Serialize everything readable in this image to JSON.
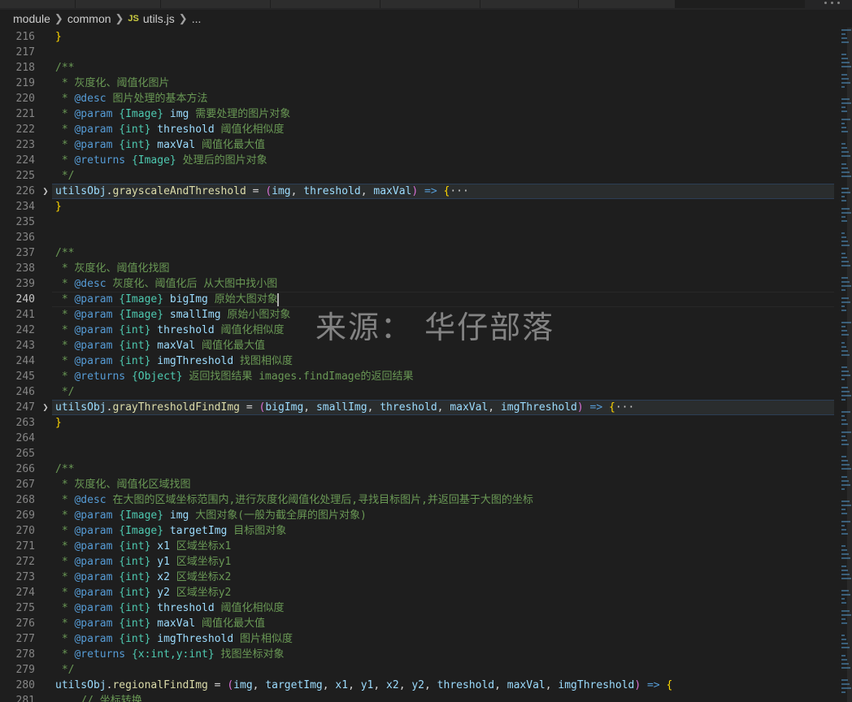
{
  "breadcrumb": {
    "segments": [
      "module",
      "common",
      "utils.js",
      "..."
    ],
    "file_icon": "JS"
  },
  "watermark": "来源： 华仔部落",
  "colors": {
    "comment": "#6a9955",
    "tag": "#569cd6",
    "type": "#4ec9b0",
    "param": "#9cdcfe",
    "function": "#dcdcaa",
    "background": "#1e1e1e"
  },
  "icons": {
    "fold_collapsed": "chevron-right-icon",
    "breadcrumb_separator": "chevron-right-icon",
    "file_type": "js-file-icon"
  },
  "lines": [
    {
      "n": "216",
      "t": "}"
    },
    {
      "n": "217",
      "t": ""
    },
    {
      "n": "218",
      "t": "/**"
    },
    {
      "n": "219",
      "t": " * 灰度化、阈值化图片"
    },
    {
      "n": "220",
      "t": " * @desc 图片处理的基本方法"
    },
    {
      "n": "221",
      "t": " * @param {Image} img 需要处理的图片对象"
    },
    {
      "n": "222",
      "t": " * @param {int} threshold 阈值化相似度"
    },
    {
      "n": "223",
      "t": " * @param {int} maxVal 阈值化最大值"
    },
    {
      "n": "224",
      "t": " * @returns {Image} 处理后的图片对象"
    },
    {
      "n": "225",
      "t": " */"
    },
    {
      "n": "226",
      "t": "utilsObj.grayscaleAndThreshold = (img, threshold, maxVal) => {···",
      "fold": true,
      "hl": true
    },
    {
      "n": "234",
      "t": "}"
    },
    {
      "n": "235",
      "t": ""
    },
    {
      "n": "236",
      "t": ""
    },
    {
      "n": "237",
      "t": "/**"
    },
    {
      "n": "238",
      "t": " * 灰度化、阈值化找图"
    },
    {
      "n": "239",
      "t": " * @desc 灰度化、阈值化后 从大图中找小图"
    },
    {
      "n": "240",
      "t": " * @param {Image} bigImg 原始大图对象",
      "cur": true
    },
    {
      "n": "241",
      "t": " * @param {Image} smallImg 原始小图对象"
    },
    {
      "n": "242",
      "t": " * @param {int} threshold 阈值化相似度"
    },
    {
      "n": "243",
      "t": " * @param {int} maxVal 阈值化最大值"
    },
    {
      "n": "244",
      "t": " * @param {int} imgThreshold 找图相似度"
    },
    {
      "n": "245",
      "t": " * @returns {Object} 返回找图结果 images.findImage的返回结果"
    },
    {
      "n": "246",
      "t": " */"
    },
    {
      "n": "247",
      "t": "utilsObj.grayThresholdFindImg = (bigImg, smallImg, threshold, maxVal, imgThreshold) => {···",
      "fold": true,
      "hl": true
    },
    {
      "n": "263",
      "t": "}"
    },
    {
      "n": "264",
      "t": ""
    },
    {
      "n": "265",
      "t": ""
    },
    {
      "n": "266",
      "t": "/**"
    },
    {
      "n": "267",
      "t": " * 灰度化、阈值化区域找图"
    },
    {
      "n": "268",
      "t": " * @desc 在大图的区域坐标范围内,进行灰度化阈值化处理后,寻找目标图片,并返回基于大图的坐标"
    },
    {
      "n": "269",
      "t": " * @param {Image} img 大图对象(一般为截全屏的图片对象)"
    },
    {
      "n": "270",
      "t": " * @param {Image} targetImg 目标图对象"
    },
    {
      "n": "271",
      "t": " * @param {int} x1 区域坐标x1"
    },
    {
      "n": "272",
      "t": " * @param {int} y1 区域坐标y1"
    },
    {
      "n": "273",
      "t": " * @param {int} x2 区域坐标x2"
    },
    {
      "n": "274",
      "t": " * @param {int} y2 区域坐标y2"
    },
    {
      "n": "275",
      "t": " * @param {int} threshold 阈值化相似度"
    },
    {
      "n": "276",
      "t": " * @param {int} maxVal 阈值化最大值"
    },
    {
      "n": "277",
      "t": " * @param {int} imgThreshold 图片相似度"
    },
    {
      "n": "278",
      "t": " * @returns {x:int,y:int} 找图坐标对象"
    },
    {
      "n": "279",
      "t": " */"
    },
    {
      "n": "280",
      "t": "utilsObj.regionalFindImg = (img, targetImg, x1, y1, x2, y2, threshold, maxVal, imgThreshold) => {"
    },
    {
      "n": "281",
      "t": "    // 坐标转换"
    }
  ]
}
